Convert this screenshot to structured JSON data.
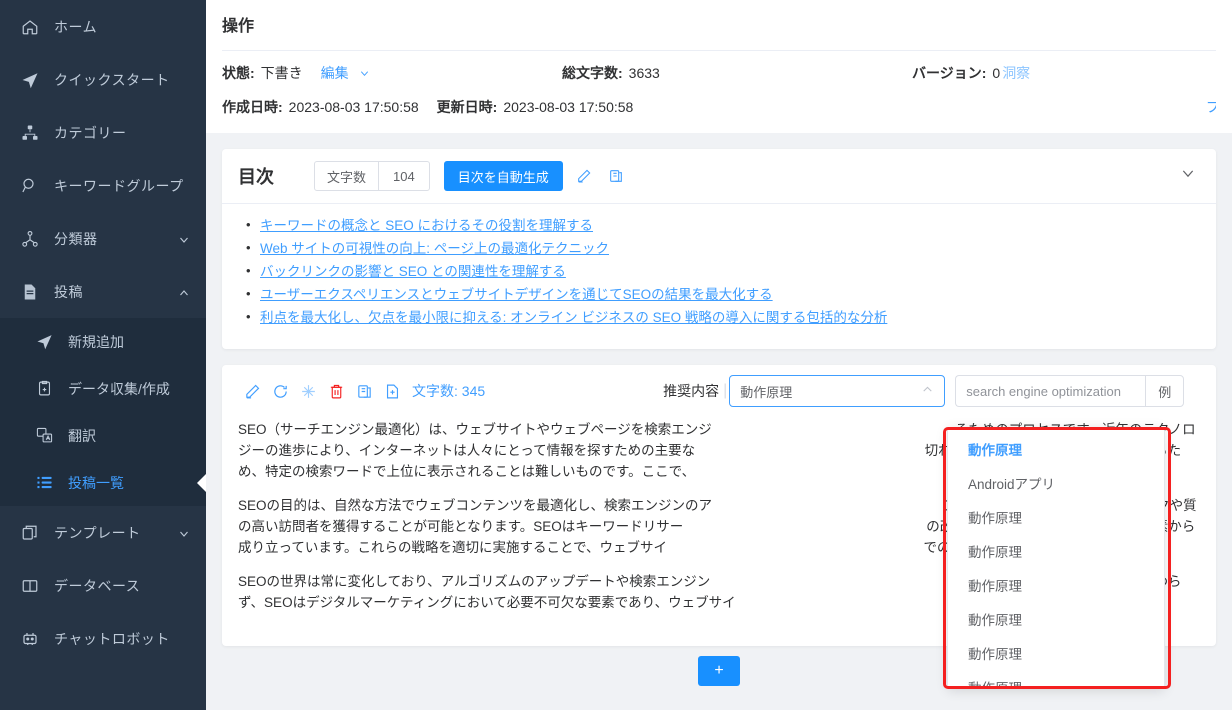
{
  "sidebar": {
    "items": [
      {
        "icon": "home-icon",
        "label": "ホーム",
        "chevron": false
      },
      {
        "icon": "rocket-icon",
        "label": "クイックスタート",
        "chevron": false
      },
      {
        "icon": "category-icon",
        "label": "カテゴリー",
        "chevron": false
      },
      {
        "icon": "keyword-search-icon",
        "label": "キーワードグループ",
        "chevron": false
      },
      {
        "icon": "classifier-icon",
        "label": "分類器",
        "chevron": "down"
      },
      {
        "icon": "document-icon",
        "label": "投稿",
        "chevron": "up"
      }
    ],
    "sub_items": [
      {
        "icon": "send-icon",
        "label": "新規追加",
        "active": false
      },
      {
        "icon": "clipboard-plus-icon",
        "label": "データ収集/作成",
        "active": false
      },
      {
        "icon": "translate-icon",
        "label": "翻訳",
        "active": false
      },
      {
        "icon": "list-icon",
        "label": "投稿一覧",
        "active": true
      }
    ],
    "bottom_items": [
      {
        "icon": "template-icon",
        "label": "テンプレート",
        "chevron": "down"
      },
      {
        "icon": "database-icon",
        "label": "データベース",
        "chevron": false
      },
      {
        "icon": "robot-icon",
        "label": "チャットロボット",
        "chevron": false
      }
    ]
  },
  "header": {
    "title": "操作",
    "status_label": "状態:",
    "status_value": "下書き",
    "edit_link": "編集",
    "total_chars_label": "総文字数:",
    "total_chars_value": "3633",
    "version_label": "バージョン:",
    "version_value": "0",
    "insight_link": "洞察",
    "created_label": "作成日時:",
    "created_value": "2023-08-03 17:50:58",
    "updated_label": "更新日時:",
    "updated_value": "2023-08-03 17:50:58",
    "preview_link": "プ"
  },
  "toc": {
    "title": "目次",
    "count_label": "文字数",
    "count_value": "104",
    "generate_button": "目次を自動生成",
    "edit_icon": "pencil-icon",
    "copy_icon": "copy-icon",
    "collapse_icon": "chevron-down-icon",
    "items": [
      "キーワードの概念と SEO におけるその役割を理解する",
      "Web サイトの可視性の向上: ページ上の最適化テクニック",
      "バックリンクの影響と SEO との関連性を理解する",
      "ユーザーエクスペリエンスとウェブサイトデザインを通じてSEOの結果を最大化する",
      "利点を最大化し、欠点を最小限に抑える: オンライン ビジネスの SEO 戦略の導入に関する包括的な分析"
    ]
  },
  "editor": {
    "toolbar_icons": [
      "pencil-icon",
      "refresh-icon",
      "sparkle-icon",
      "trash-icon",
      "copy-icon",
      "add-document-icon"
    ],
    "wordcount_label": "文字数:",
    "wordcount_value": "345",
    "recommend_label": "推奨内容",
    "select_value": "動作原理",
    "select_arrow": "chevron-up-icon",
    "keyword_value": "search engine optimization",
    "example_button": "例",
    "paragraphs": [
      "SEO（サーチエンジン最適化）は、ウェブサイトやウェブページを検索エンジ　　　　　　　　　　　　　　　　　　るためのプロセスです。近年のテクノロジーの進歩により、インターネットは人々にとって情報を探すための主要な　　　　　　　　　　　　　　　　　切れないほどのウェブサイトが存在するため、特定の検索ワードで上位に表示されることは難しいものです。ここで、　　　　　　　　　　　　　　　　　　　　ます。",
      "SEOの目的は、自然な方法でウェブコンテンツを最適化し、検索エンジンのア　　　　　　　　　　　　　　　　　これにより、より多くのトラフィックや質の高い訪問者を獲得することが可能となります。SEOはキーワードリサー　　　　　　　　　　　　　　　　　　の改善、リンクビルディングなどの要素から成り立っています。これらの戦略を適切に実施することで、ウェブサイ　　　　　　　　　　　　　　　　　　　での競争に勝つことができます。",
      "SEOの世界は常に変化しており、アルゴリズムのアップデートや検索エンジン　　　　　　　　　　　　　　　　　　　　要があります。それにもかかわらず、SEOはデジタルマーケティングにおいて必要不可欠な要素であり、ウェブサイ"
    ],
    "add_button": "+"
  },
  "dropdown": {
    "options": [
      {
        "label": "動作原理",
        "selected": true
      },
      {
        "label": "Androidアプリ",
        "selected": false
      },
      {
        "label": "動作原理",
        "selected": false
      },
      {
        "label": "動作原理",
        "selected": false
      },
      {
        "label": "動作原理",
        "selected": false
      },
      {
        "label": "動作原理",
        "selected": false
      },
      {
        "label": "動作原理",
        "selected": false
      },
      {
        "label": "動作原理",
        "selected": false
      }
    ]
  },
  "colors": {
    "sidebar_bg": "#263445",
    "sidebar_sub_bg": "#1f2d3d",
    "accent": "#409eff",
    "primary_button": "#1890ff",
    "highlight_border": "#f42020",
    "danger": "#f56c6c"
  }
}
